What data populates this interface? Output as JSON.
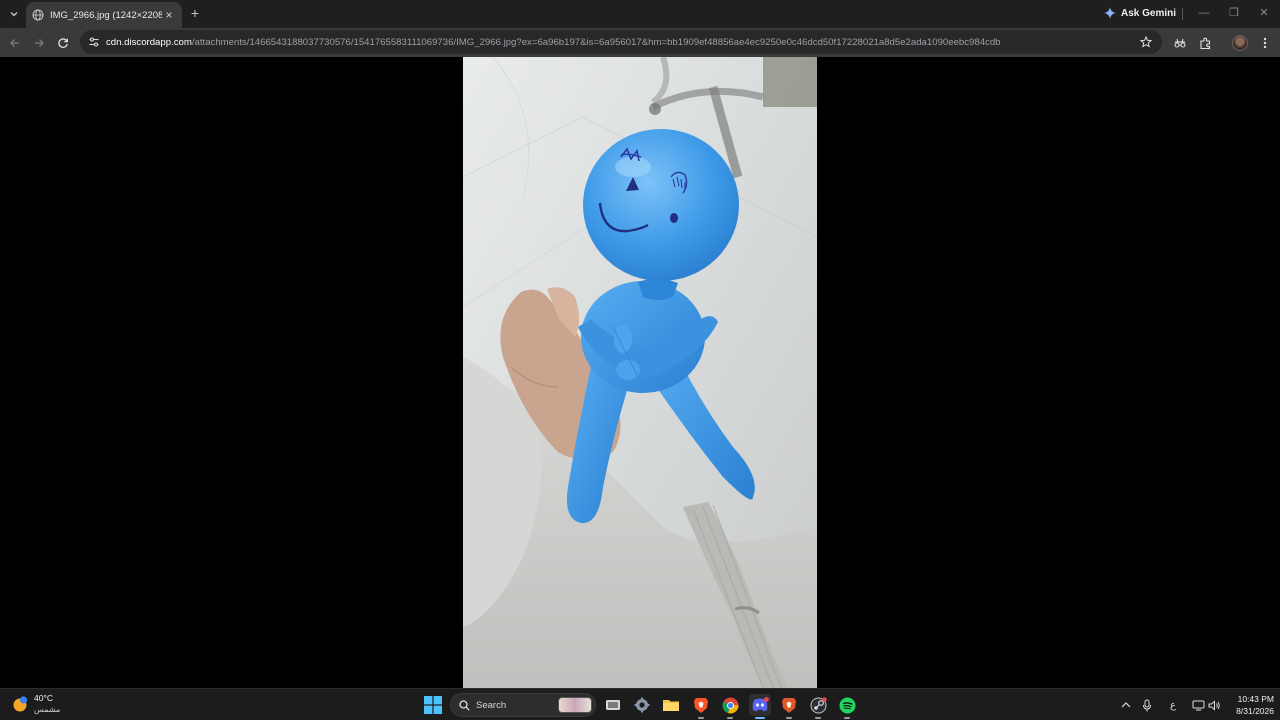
{
  "tab": {
    "title": "IMG_2966.jpg (1242×2208)",
    "close_label": "×",
    "new_tab_label": "+"
  },
  "ask_gemini": "Ask Gemini",
  "window_controls": {
    "minimize": "—",
    "restore": "❐",
    "close": "✕"
  },
  "address_bar": {
    "host": "cdn.discordapp.com",
    "path": "/attachments/1466543188037730576/1541765583111069736/IMG_2966.jpg?ex=6a96b197&is=6a956017&hm=bb1909ef48856ae4ec9250e0c46dcd50f17228021a8d5e2ada1090eebc984cdb"
  },
  "taskbar": {
    "weather": {
      "temp": "40°C",
      "desc": "مشمس"
    },
    "search_label": "Search",
    "language": "ع",
    "clock": {
      "time": "10:43 PM",
      "date": "8/31/2026"
    }
  },
  "colors": {
    "tab_bg": "#1f1f1f",
    "toolbar_bg": "#3a3a3a",
    "omnibox_bg": "#282828",
    "taskbar_bg": "#1c1c1c",
    "balloon": "#3d9ae8"
  }
}
